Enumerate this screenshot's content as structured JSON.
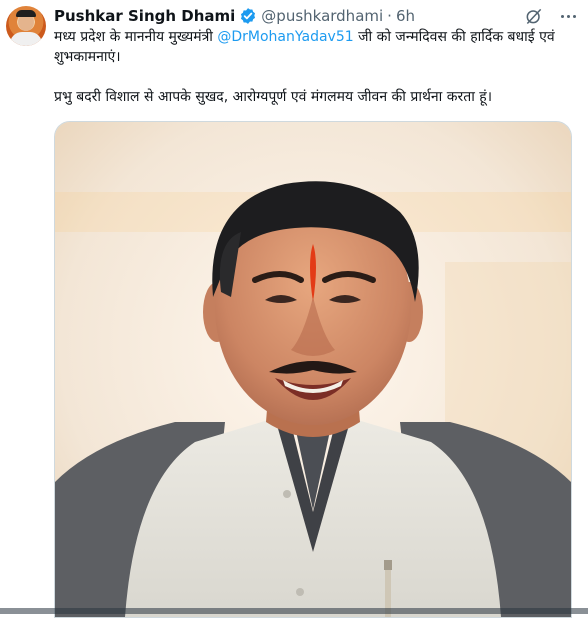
{
  "tweet": {
    "author_name": "Pushkar Singh Dhami",
    "handle": "@pushkardhami",
    "separator": "·",
    "time": "6h",
    "line1_prefix": "मध्य प्रदेश के माननीय मुख्यमंत्री ",
    "mention": "@DrMohanYadav51",
    "line1_suffix": " जी को जन्मदिवस की हार्दिक बधाई एवं शुभकामनाएं।",
    "line2": "प्रभु बदरी विशाल से आपके सुखद, आरोग्यपूर्ण एवं मंगलमय जीवन की प्रार्थना करता हूं।"
  },
  "icons": {
    "verified": "verified-badge-icon",
    "grok": "grok-icon",
    "more": "more-options-icon"
  },
  "colors": {
    "text": "#0f1419",
    "secondary": "#536471",
    "link": "#1d9bf0",
    "verified": "#1d9bf0",
    "media_border": "#cfd9de"
  }
}
